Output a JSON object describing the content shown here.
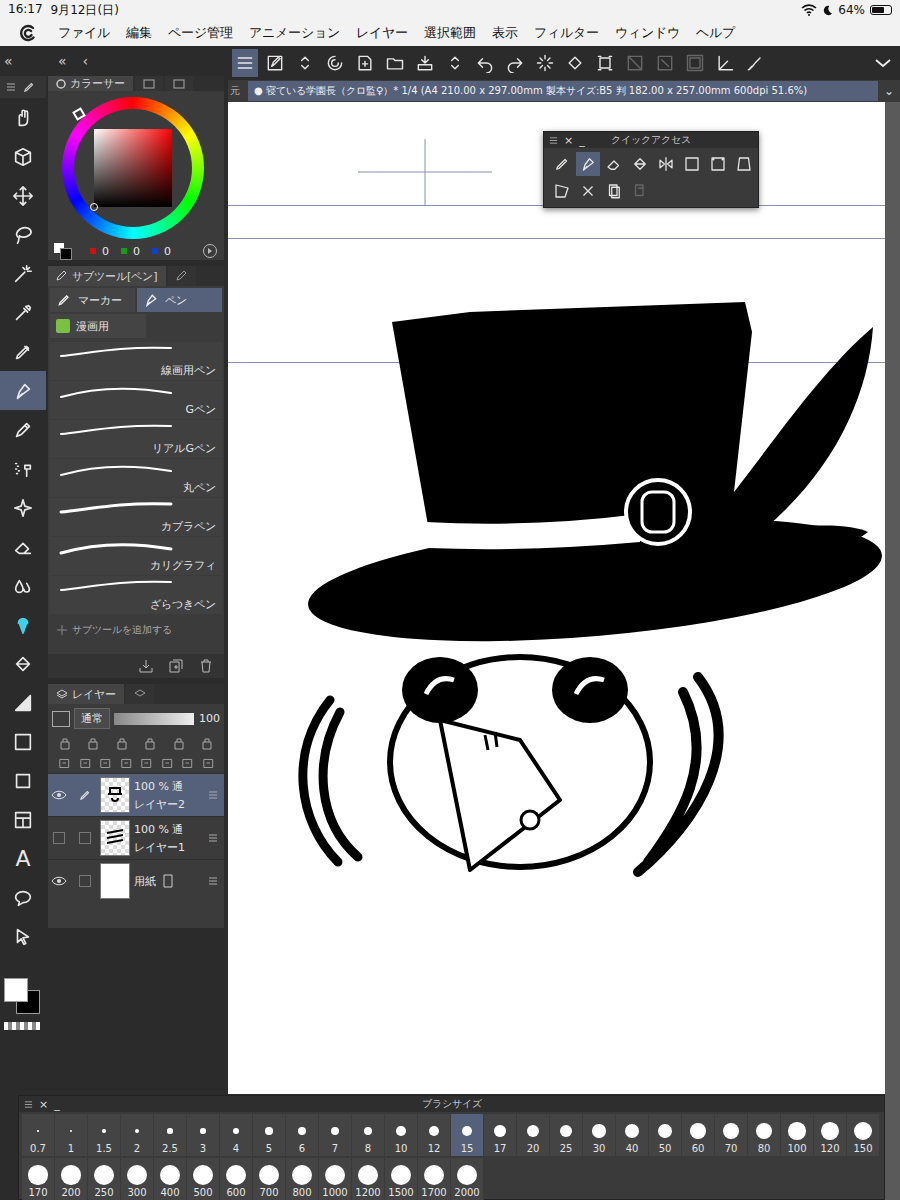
{
  "status_bar": {
    "time": "16:17",
    "date": "9月12日(日)",
    "battery": "64%",
    "battery_level": 0.64
  },
  "menu_bar": {
    "items": [
      "ファイル",
      "編集",
      "ページ管理",
      "アニメーション",
      "レイヤー",
      "選択範囲",
      "表示",
      "フィルター",
      "ウィンドウ",
      "ヘルプ"
    ]
  },
  "toolbox": {
    "collapse": "«",
    "tools": [
      {
        "selected": false
      },
      {
        "selected": false
      },
      {
        "selected": false
      },
      {
        "selected": false
      },
      {
        "selected": false
      },
      {
        "selected": false
      },
      {
        "selected": false
      },
      {
        "selected": true
      },
      {
        "selected": false
      },
      {
        "selected": false
      },
      {
        "selected": false
      },
      {
        "selected": false
      },
      {
        "selected": false
      },
      {
        "selected": false
      },
      {
        "selected": false
      },
      {
        "selected": false
      },
      {
        "selected": false
      },
      {
        "selected": false
      },
      {
        "selected": false
      },
      {
        "selected": false,
        "glyph": "A"
      },
      {
        "selected": false
      },
      {
        "selected": false
      }
    ]
  },
  "colors": {
    "main": "#ffffff",
    "sub": "#000000"
  },
  "panel_strip": {
    "collapse": "«",
    "back": "‹"
  },
  "commands": [
    {
      "selected": true,
      "disabled": false
    },
    {
      "selected": false,
      "disabled": false
    },
    {
      "selected": false,
      "disabled": false
    },
    {
      "selected": false,
      "disabled": false
    },
    {
      "selected": false,
      "disabled": false
    },
    {
      "selected": false,
      "disabled": false
    },
    {
      "selected": false,
      "disabled": false
    },
    {
      "selected": false,
      "disabled": false
    },
    {
      "selected": false,
      "disabled": false
    },
    {
      "selected": false,
      "disabled": false
    },
    {
      "selected": false,
      "disabled": false
    },
    {
      "selected": false,
      "disabled": false
    },
    {
      "selected": false,
      "disabled": false
    },
    {
      "selected": false,
      "disabled": true
    },
    {
      "selected": false,
      "disabled": true
    },
    {
      "selected": false,
      "disabled": true
    },
    {
      "selected": false,
      "disabled": false
    },
    {
      "selected": false,
      "disabled": false
    }
  ],
  "document_tab": {
    "prev": "元",
    "title": "● 寝ている学園長（クロ監♀）* 1/4 (A4 210.00 x 297.00mm 製本サイズ:B5 判 182.00 x 257.00mm 600dpi 51.6%)",
    "menu": "⌄"
  },
  "color_panel": {
    "title": "カラーサー",
    "rgb": [
      {
        "value": "0",
        "color": "#d01010"
      },
      {
        "value": "0",
        "color": "#10a010"
      },
      {
        "value": "0",
        "color": "#1040d0"
      }
    ]
  },
  "subtool_panel": {
    "title": "サブツール[ペン]",
    "groups": [
      {
        "label": "マーカー",
        "selected": false
      },
      {
        "label": "ペン",
        "selected": true
      }
    ],
    "category": "漫画用",
    "items": [
      {
        "label": "線画用ペン",
        "selected": true
      },
      {
        "label": "Gペン",
        "selected": false
      },
      {
        "label": "リアルGペン",
        "selected": false
      },
      {
        "label": "丸ペン",
        "selected": false
      },
      {
        "label": "カブラペン",
        "selected": false
      },
      {
        "label": "カリグラフィ",
        "selected": false
      },
      {
        "label": "ざらつきペン",
        "selected": false
      }
    ],
    "add_label": "サブツールを追加する"
  },
  "layer_panel": {
    "title": "レイヤー",
    "blend": "通常",
    "opacity": "100",
    "layers": [
      {
        "name": "レイヤー2",
        "info": "100 % 通",
        "visible": true,
        "editing": true,
        "selected": true,
        "kind": "raster"
      },
      {
        "name": "レイヤー1",
        "info": "100 % 通",
        "visible": false,
        "editing": false,
        "selected": false,
        "kind": "raster"
      },
      {
        "name": "用紙",
        "info": "",
        "visible": true,
        "editing": false,
        "selected": false,
        "kind": "paper"
      }
    ]
  },
  "quick_access": {
    "title": "クイックアクセス",
    "close": "×",
    "minimize": "_",
    "items": [
      {
        "selected": false
      },
      {
        "selected": true
      },
      {
        "selected": false
      },
      {
        "selected": false
      },
      {
        "selected": false
      },
      {
        "selected": false
      },
      {
        "selected": false
      },
      {
        "selected": false
      },
      {
        "selected": false
      },
      {
        "selected": false
      },
      {
        "selected": false
      },
      {
        "selected": false,
        "disabled": true
      }
    ]
  },
  "brush_size": {
    "title": "ブラシサイズ",
    "close": "×",
    "minimize": "_",
    "sizes": [
      {
        "label": "0.7",
        "selected": false
      },
      {
        "label": "1",
        "selected": false
      },
      {
        "label": "1.5",
        "selected": false
      },
      {
        "label": "2",
        "selected": false
      },
      {
        "label": "2.5",
        "selected": false
      },
      {
        "label": "3",
        "selected": false
      },
      {
        "label": "4",
        "selected": false
      },
      {
        "label": "5",
        "selected": false
      },
      {
        "label": "6",
        "selected": false
      },
      {
        "label": "7",
        "selected": false
      },
      {
        "label": "8",
        "selected": false
      },
      {
        "label": "10",
        "selected": false
      },
      {
        "label": "12",
        "selected": false
      },
      {
        "label": "15",
        "selected": true
      },
      {
        "label": "17",
        "selected": false
      },
      {
        "label": "20",
        "selected": false
      },
      {
        "label": "25",
        "selected": false
      },
      {
        "label": "30",
        "selected": false
      },
      {
        "label": "40",
        "selected": false
      },
      {
        "label": "50",
        "selected": false
      },
      {
        "label": "60",
        "selected": false
      },
      {
        "label": "70",
        "selected": false
      },
      {
        "label": "80",
        "selected": false
      },
      {
        "label": "100",
        "selected": false
      },
      {
        "label": "120",
        "selected": false
      },
      {
        "label": "150",
        "selected": false
      },
      {
        "label": "170",
        "selected": false
      },
      {
        "label": "200",
        "selected": false
      },
      {
        "label": "250",
        "selected": false
      },
      {
        "label": "300",
        "selected": false
      },
      {
        "label": "400",
        "selected": false
      },
      {
        "label": "500",
        "selected": false
      },
      {
        "label": "600",
        "selected": false
      },
      {
        "label": "700",
        "selected": false
      },
      {
        "label": "800",
        "selected": false
      },
      {
        "label": "1000",
        "selected": false
      },
      {
        "label": "1200",
        "selected": false
      },
      {
        "label": "1500",
        "selected": false
      },
      {
        "label": "1700",
        "selected": false
      },
      {
        "label": "2000",
        "selected": false
      }
    ]
  }
}
